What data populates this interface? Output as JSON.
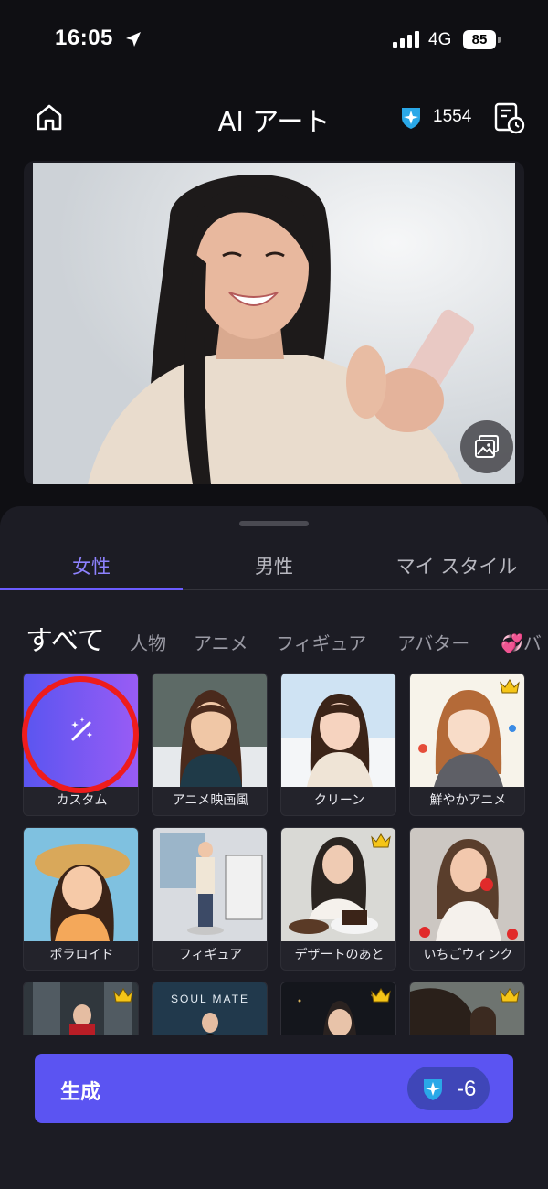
{
  "status_bar": {
    "time": "16:05",
    "network": "4G",
    "battery": "85"
  },
  "header": {
    "title": "AI アート",
    "credits": "1554"
  },
  "tabs": [
    {
      "label": "女性",
      "active": true
    },
    {
      "label": "男性",
      "active": false
    },
    {
      "label": "マイ スタイル",
      "active": false
    }
  ],
  "categories": [
    "すべて",
    "人物",
    "アニメ",
    "フィギュア",
    "アバター",
    "💞バ"
  ],
  "styles": [
    {
      "label": "カスタム",
      "icon": "magic-wand-icon",
      "premium": false
    },
    {
      "label": "アニメ映画風",
      "premium": false
    },
    {
      "label": "クリーン",
      "premium": false
    },
    {
      "label": "鮮やかアニメ",
      "premium": true
    },
    {
      "label": "ポラロイド",
      "premium": false
    },
    {
      "label": "フィギュア",
      "premium": false
    },
    {
      "label": "デザートのあと",
      "premium": true
    },
    {
      "label": "いちごウィンク",
      "premium": false
    },
    {
      "label": "",
      "premium": true
    },
    {
      "label": "",
      "thumb_text": "SOUL MATE",
      "premium": false
    },
    {
      "label": "",
      "premium": true
    },
    {
      "label": "",
      "premium": true
    }
  ],
  "generate": {
    "label": "生成",
    "cost": "-6"
  },
  "colors": {
    "accent": "#5b54f2",
    "tab_active": "#8e82ff",
    "highlight_ring": "#ee1c1c",
    "crown": "#f5c518"
  }
}
